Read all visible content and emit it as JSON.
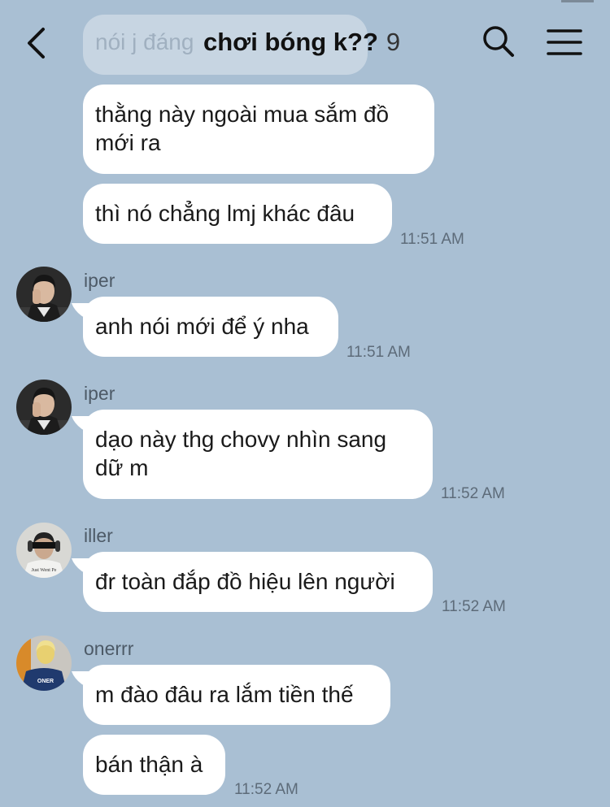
{
  "header": {
    "title": "chơi bóng k??",
    "member_count": "9",
    "behind_text": "nói j đáng"
  },
  "messages": [
    {
      "id": "m1",
      "sender": "",
      "text_lines": [
        "thằng này ngoài mua sắm đồ",
        "mới ra"
      ],
      "time": ""
    },
    {
      "id": "m2",
      "sender": "",
      "text_lines": [
        "thì nó chẳng lmj khác đâu"
      ],
      "time": "11:51 AM"
    },
    {
      "id": "m3",
      "sender": "iper",
      "text_lines": [
        "anh nói mới để ý nha"
      ],
      "time": "11:51 AM"
    },
    {
      "id": "m4",
      "sender": "iper",
      "text_lines": [
        "dạo này thg chovy nhìn sang",
        "dữ m"
      ],
      "time": "11:52 AM"
    },
    {
      "id": "m5",
      "sender": "iller",
      "text_lines": [
        "đr toàn đắp đồ hiệu lên người"
      ],
      "time": "11:52 AM"
    },
    {
      "id": "m6",
      "sender": "onerrr",
      "text_lines": [
        "m đào đâu ra lắm tiền thế"
      ],
      "time": ""
    },
    {
      "id": "m7",
      "sender": "",
      "text_lines": [
        "bán thận à"
      ],
      "time": "11:52 AM"
    }
  ],
  "avatar_text": {
    "iller_shirt": "Just Went Pe",
    "onerrr_jacket": "ONER"
  },
  "colors": {
    "background": "#a9bfd3",
    "bubble": "#ffffff",
    "time": "#5d6b79",
    "name": "#4d5a67"
  },
  "icons": {
    "back": "chevron-left-icon",
    "search": "search-icon",
    "menu": "hamburger-menu-icon"
  }
}
